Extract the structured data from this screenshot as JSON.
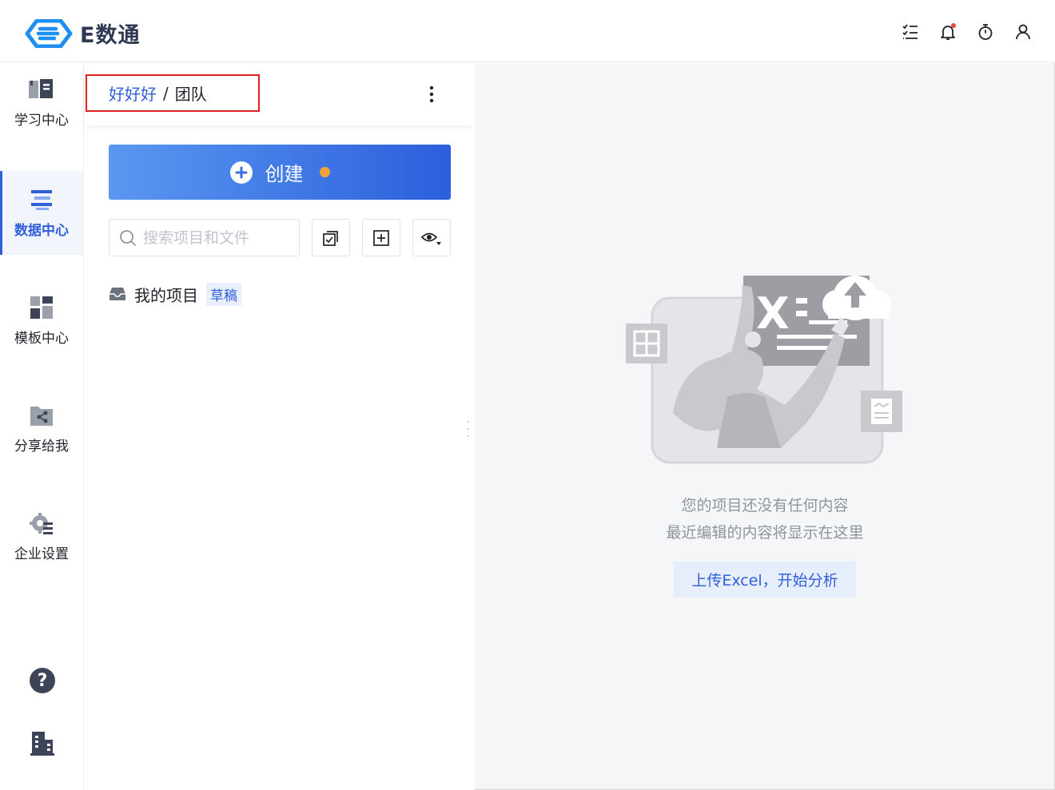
{
  "app": {
    "name": "E数通",
    "brand_color": "#1f8ef1",
    "accent_color": "#2f5fd9"
  },
  "header": {
    "icons": [
      "task-list-icon",
      "notification-bell-icon",
      "timer-icon",
      "user-icon"
    ]
  },
  "rail": {
    "items": [
      {
        "label": "学习中心",
        "icon": "book-icon"
      },
      {
        "label": "数据中心",
        "icon": "data-list-icon",
        "active": true
      },
      {
        "label": "模板中心",
        "icon": "template-grid-icon"
      },
      {
        "label": "分享给我",
        "icon": "shared-folder-icon"
      },
      {
        "label": "企业设置",
        "icon": "enterprise-settings-icon"
      }
    ],
    "bottom_icons": [
      "help-icon",
      "building-icon"
    ]
  },
  "panel": {
    "breadcrumb": {
      "parent": "好好好",
      "separator": "/",
      "current": "团队"
    },
    "create_label": "创建",
    "search": {
      "placeholder": "搜索项目和文件",
      "value": ""
    },
    "tools": [
      "batch-select-icon",
      "add-folder-icon",
      "view-eye-icon"
    ],
    "project": {
      "label": "我的项目",
      "badge": "草稿"
    }
  },
  "main": {
    "empty_line1": "您的项目还没有任何内容",
    "empty_line2": "最近编辑的内容将显示在这里",
    "upload_label": "上传Excel，开始分析"
  }
}
